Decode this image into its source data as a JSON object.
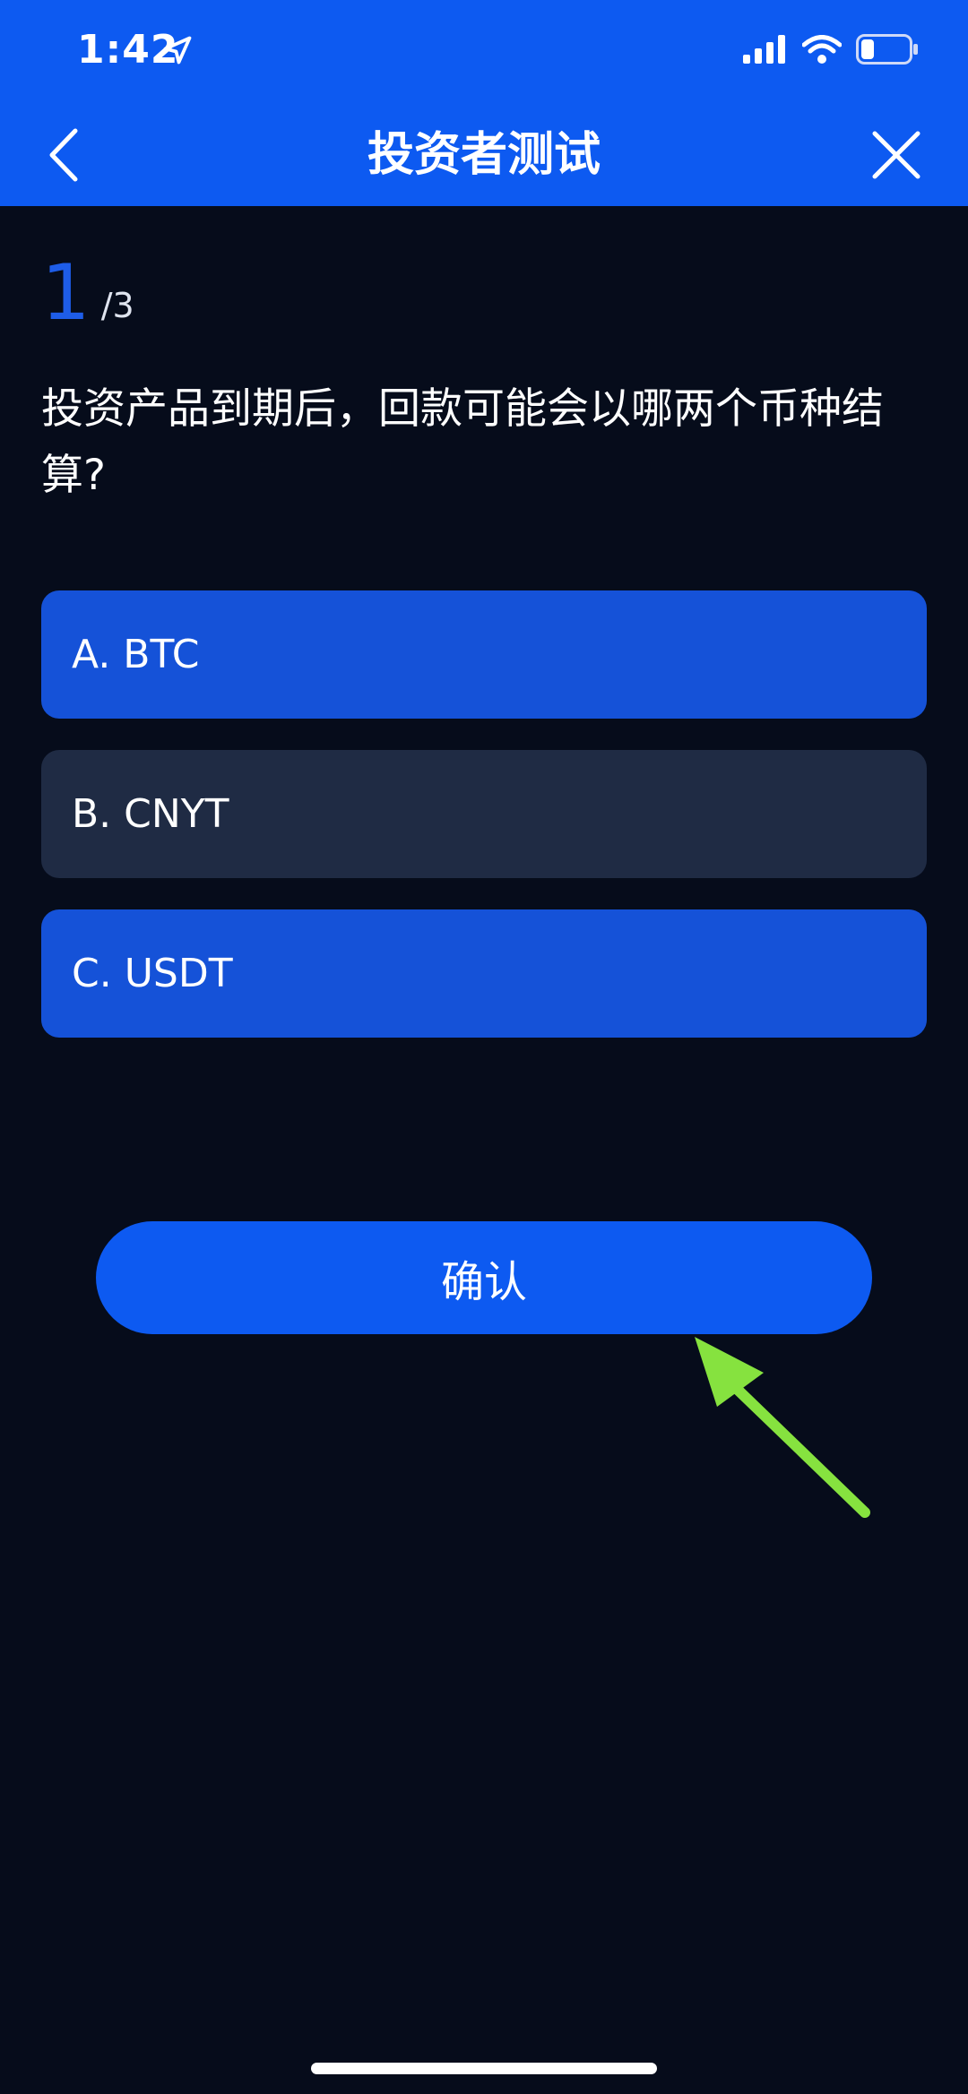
{
  "status_bar": {
    "time": "1:42",
    "icons": [
      "location-arrow-icon",
      "cellular-signal-icon",
      "wifi-icon",
      "battery-icon"
    ]
  },
  "header": {
    "title": "投资者测试",
    "back_icon": "chevron-left-icon",
    "close_icon": "close-icon"
  },
  "quiz": {
    "progress": {
      "current": "1",
      "total": "/3"
    },
    "question": "投资产品到期后，回款可能会以哪两个币种结算?",
    "options": [
      {
        "label": "A. BTC",
        "selected": true
      },
      {
        "label": "B. CNYT",
        "selected": false
      },
      {
        "label": "C. USDT",
        "selected": true
      }
    ],
    "confirm_label": "确认"
  },
  "colors": {
    "header_bg": "#0d5af1",
    "page_bg": "#060c1b",
    "option_selected": "#1552d8",
    "option_unselected": "#1f2b44",
    "accent": "#1e5de8",
    "annotation_arrow": "#86e23f"
  }
}
